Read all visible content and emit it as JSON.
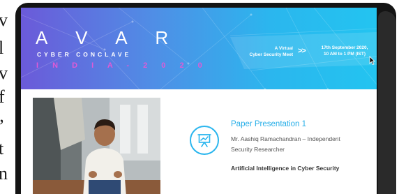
{
  "background_text": [
    "v",
    "l",
    "v",
    "f",
    "’",
    "t",
    "n"
  ],
  "banner": {
    "title": "A V A R",
    "subtitle": "CYBER CONCLAVE",
    "edition": "I N D I A - 2 0 2 0",
    "tagline_line1": "A Virtual",
    "tagline_line2": "Cyber Security Meet",
    "date_line1": "17th September 2020,",
    "date_line2": "10 AM to 1 PM (IST)"
  },
  "session": {
    "title": "Paper Presentation 1",
    "speaker_line1": "Mr. Aashiq Ramachandran – Independent",
    "speaker_line2": "Security Researcher",
    "topic": "Artificial Intelligence in Cyber Security"
  },
  "colors": {
    "accent": "#26aee8",
    "banner_start": "#6b5ad9",
    "banner_end": "#23c4f0",
    "edition_pink": "#e05ad6"
  }
}
